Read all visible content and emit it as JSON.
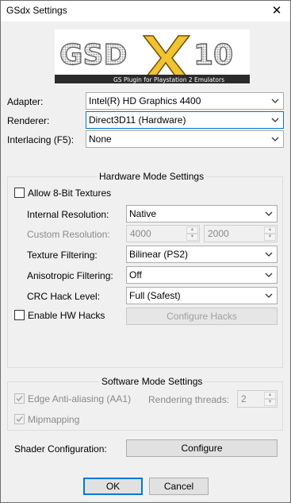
{
  "window": {
    "title": "GSdx Settings",
    "close_glyph": "✕"
  },
  "logo": {
    "main": "GSD",
    "x": "X",
    "ten": "10",
    "tagline": "GS Plugin  for Playstation 2 Emulators"
  },
  "general": {
    "adapter_label": "Adapter:",
    "adapter_value": "Intel(R) HD Graphics 4400",
    "renderer_label": "Renderer:",
    "renderer_value": "Direct3D11 (Hardware)",
    "interlacing_label": "Interlacing (F5):",
    "interlacing_value": "None"
  },
  "hardware": {
    "title": "Hardware Mode Settings",
    "allow_8bit_label": "Allow 8-Bit Textures",
    "internal_res_label": "Internal Resolution:",
    "internal_res_value": "Native",
    "custom_res_label": "Custom Resolution:",
    "custom_res_w": "4000",
    "custom_res_h": "2000",
    "texture_filter_label": "Texture Filtering:",
    "texture_filter_value": "Bilinear (PS2)",
    "aniso_label": "Anisotropic Filtering:",
    "aniso_value": "Off",
    "crc_label": "CRC Hack Level:",
    "crc_value": "Full (Safest)",
    "enable_hw_hacks_label": "Enable HW Hacks",
    "configure_hacks_label": "Configure Hacks"
  },
  "software": {
    "title": "Software Mode Settings",
    "aa1_label": "Edge Anti-aliasing (AA1)",
    "threads_label": "Rendering threads:",
    "threads_value": "2",
    "mipmapping_label": "Mipmapping"
  },
  "shader": {
    "label": "Shader Configuration:",
    "button": "Configure"
  },
  "footer": {
    "ok": "OK",
    "cancel": "Cancel"
  },
  "colors": {
    "accent": "#0078d7",
    "disabled_text": "#8a8a8a"
  }
}
